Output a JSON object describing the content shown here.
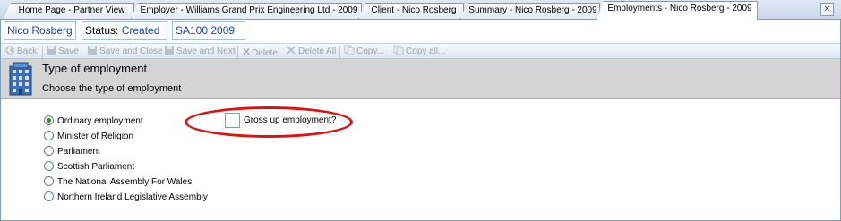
{
  "tabs": [
    {
      "label": "Home Page - Partner View",
      "active": false
    },
    {
      "label": "Employer - Williams Grand Prix Engineering Ltd - 2009",
      "active": false
    },
    {
      "label": "Client - Nico Rosberg",
      "active": false
    },
    {
      "label": "Summary - Nico Rosberg - 2009",
      "active": false
    },
    {
      "label": "Employments - Nico Rosberg - 2009",
      "active": true
    }
  ],
  "close_label": "×",
  "status_bar": {
    "client": "Nico Rosberg",
    "status_label": "Status:",
    "status_value": "Created",
    "return_type": "SA100 2009"
  },
  "toolbar": {
    "back": "Back",
    "save": "Save",
    "save_close": "Save and Close",
    "save_next": "Save and Next",
    "delete": "Delete",
    "delete_all": "Delete All",
    "copy": "Copy...",
    "copy_all": "Copy all..."
  },
  "section": {
    "title": "Type of employment",
    "subtitle": "Choose the type of employment",
    "icon": "building-icon"
  },
  "employment_types": [
    {
      "label": "Ordinary employment",
      "selected": true
    },
    {
      "label": "Minister of Religion",
      "selected": false
    },
    {
      "label": "Parliament",
      "selected": false
    },
    {
      "label": "Scottish Parliament",
      "selected": false
    },
    {
      "label": "The National Assembly For Wales",
      "selected": false
    },
    {
      "label": "Northern Ireland Legislative Assembly",
      "selected": false
    }
  ],
  "gross_up": {
    "label": "Gross up employment?",
    "checked": false
  },
  "colors": {
    "highlight": "#e01010",
    "accent": "#1a3fbf"
  }
}
